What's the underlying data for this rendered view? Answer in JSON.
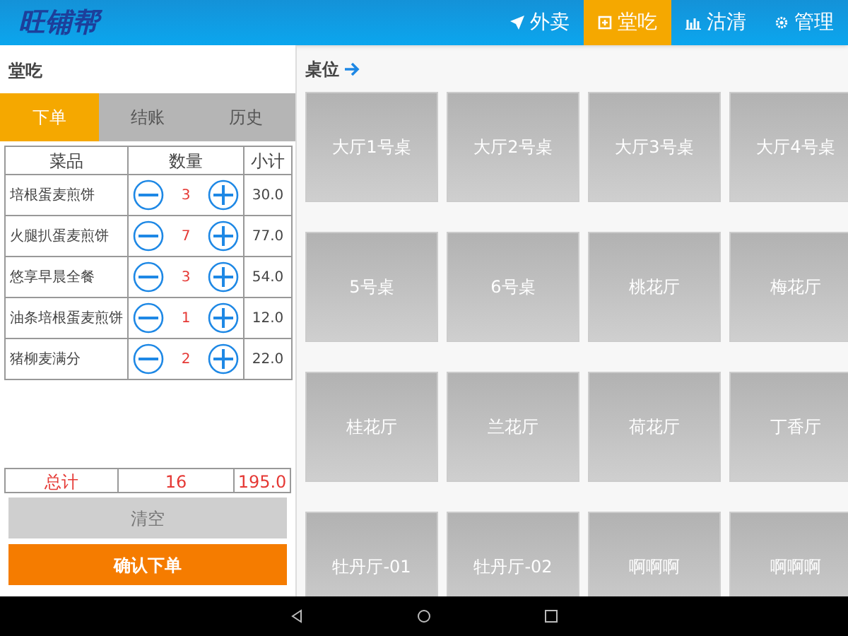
{
  "app": {
    "logo": "旺铺帮"
  },
  "nav": [
    {
      "label": "外卖",
      "kind": "send",
      "selected": false
    },
    {
      "label": "堂吃",
      "kind": "plus-square",
      "selected": true
    },
    {
      "label": "沽清",
      "kind": "chart",
      "selected": false
    },
    {
      "label": "管理",
      "kind": "gear",
      "selected": false
    }
  ],
  "order_panel": {
    "title": "堂吃",
    "tabs": [
      {
        "label": "下单",
        "selected": true
      },
      {
        "label": "结账",
        "selected": false
      },
      {
        "label": "历史",
        "selected": false
      }
    ],
    "table": {
      "columns": [
        "菜品",
        "数量",
        "小计"
      ],
      "rows": [
        {
          "item": "培根蛋麦煎饼",
          "qty": "3",
          "subtotal": "30.0"
        },
        {
          "item": "火腿扒蛋麦煎饼",
          "qty": "7",
          "subtotal": "77.0"
        },
        {
          "item": "悠享早晨全餐",
          "qty": "3",
          "subtotal": "54.0"
        },
        {
          "item": "油条培根蛋麦煎饼",
          "qty": "1",
          "subtotal": "12.0"
        },
        {
          "item": "猪柳麦满分",
          "qty": "2",
          "subtotal": "22.0"
        }
      ]
    },
    "total": {
      "label": "总计",
      "qty": "16",
      "amount": "195.0"
    },
    "clear_button": "清空",
    "confirm_button": "确认下单"
  },
  "tables_panel": {
    "title": "桌位",
    "tables": [
      "大厅1号桌",
      "大厅2号桌",
      "大厅3号桌",
      "大厅4号桌",
      "5号桌",
      "6号桌",
      "桃花厅",
      "梅花厅",
      "桂花厅",
      "兰花厅",
      "荷花厅",
      "丁香厅",
      "牡丹厅-01",
      "牡丹厅-02",
      "啊啊啊",
      "啊啊啊"
    ]
  }
}
